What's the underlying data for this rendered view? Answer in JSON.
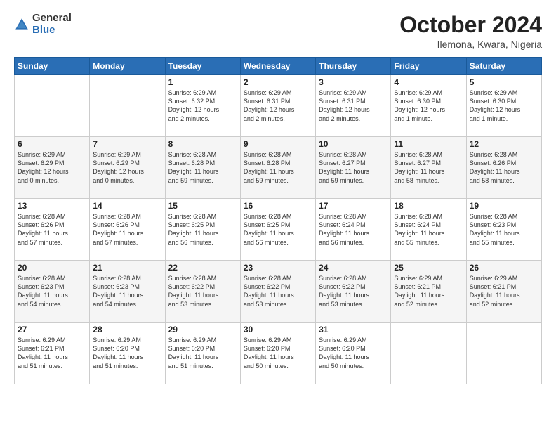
{
  "logo": {
    "general": "General",
    "blue": "Blue"
  },
  "title": {
    "month": "October 2024",
    "location": "Ilemona, Kwara, Nigeria"
  },
  "weekdays": [
    "Sunday",
    "Monday",
    "Tuesday",
    "Wednesday",
    "Thursday",
    "Friday",
    "Saturday"
  ],
  "weeks": [
    [
      {
        "day": "",
        "info": ""
      },
      {
        "day": "",
        "info": ""
      },
      {
        "day": "1",
        "info": "Sunrise: 6:29 AM\nSunset: 6:32 PM\nDaylight: 12 hours\nand 2 minutes."
      },
      {
        "day": "2",
        "info": "Sunrise: 6:29 AM\nSunset: 6:31 PM\nDaylight: 12 hours\nand 2 minutes."
      },
      {
        "day": "3",
        "info": "Sunrise: 6:29 AM\nSunset: 6:31 PM\nDaylight: 12 hours\nand 2 minutes."
      },
      {
        "day": "4",
        "info": "Sunrise: 6:29 AM\nSunset: 6:30 PM\nDaylight: 12 hours\nand 1 minute."
      },
      {
        "day": "5",
        "info": "Sunrise: 6:29 AM\nSunset: 6:30 PM\nDaylight: 12 hours\nand 1 minute."
      }
    ],
    [
      {
        "day": "6",
        "info": "Sunrise: 6:29 AM\nSunset: 6:29 PM\nDaylight: 12 hours\nand 0 minutes."
      },
      {
        "day": "7",
        "info": "Sunrise: 6:29 AM\nSunset: 6:29 PM\nDaylight: 12 hours\nand 0 minutes."
      },
      {
        "day": "8",
        "info": "Sunrise: 6:28 AM\nSunset: 6:28 PM\nDaylight: 11 hours\nand 59 minutes."
      },
      {
        "day": "9",
        "info": "Sunrise: 6:28 AM\nSunset: 6:28 PM\nDaylight: 11 hours\nand 59 minutes."
      },
      {
        "day": "10",
        "info": "Sunrise: 6:28 AM\nSunset: 6:27 PM\nDaylight: 11 hours\nand 59 minutes."
      },
      {
        "day": "11",
        "info": "Sunrise: 6:28 AM\nSunset: 6:27 PM\nDaylight: 11 hours\nand 58 minutes."
      },
      {
        "day": "12",
        "info": "Sunrise: 6:28 AM\nSunset: 6:26 PM\nDaylight: 11 hours\nand 58 minutes."
      }
    ],
    [
      {
        "day": "13",
        "info": "Sunrise: 6:28 AM\nSunset: 6:26 PM\nDaylight: 11 hours\nand 57 minutes."
      },
      {
        "day": "14",
        "info": "Sunrise: 6:28 AM\nSunset: 6:26 PM\nDaylight: 11 hours\nand 57 minutes."
      },
      {
        "day": "15",
        "info": "Sunrise: 6:28 AM\nSunset: 6:25 PM\nDaylight: 11 hours\nand 56 minutes."
      },
      {
        "day": "16",
        "info": "Sunrise: 6:28 AM\nSunset: 6:25 PM\nDaylight: 11 hours\nand 56 minutes."
      },
      {
        "day": "17",
        "info": "Sunrise: 6:28 AM\nSunset: 6:24 PM\nDaylight: 11 hours\nand 56 minutes."
      },
      {
        "day": "18",
        "info": "Sunrise: 6:28 AM\nSunset: 6:24 PM\nDaylight: 11 hours\nand 55 minutes."
      },
      {
        "day": "19",
        "info": "Sunrise: 6:28 AM\nSunset: 6:23 PM\nDaylight: 11 hours\nand 55 minutes."
      }
    ],
    [
      {
        "day": "20",
        "info": "Sunrise: 6:28 AM\nSunset: 6:23 PM\nDaylight: 11 hours\nand 54 minutes."
      },
      {
        "day": "21",
        "info": "Sunrise: 6:28 AM\nSunset: 6:23 PM\nDaylight: 11 hours\nand 54 minutes."
      },
      {
        "day": "22",
        "info": "Sunrise: 6:28 AM\nSunset: 6:22 PM\nDaylight: 11 hours\nand 53 minutes."
      },
      {
        "day": "23",
        "info": "Sunrise: 6:28 AM\nSunset: 6:22 PM\nDaylight: 11 hours\nand 53 minutes."
      },
      {
        "day": "24",
        "info": "Sunrise: 6:28 AM\nSunset: 6:22 PM\nDaylight: 11 hours\nand 53 minutes."
      },
      {
        "day": "25",
        "info": "Sunrise: 6:29 AM\nSunset: 6:21 PM\nDaylight: 11 hours\nand 52 minutes."
      },
      {
        "day": "26",
        "info": "Sunrise: 6:29 AM\nSunset: 6:21 PM\nDaylight: 11 hours\nand 52 minutes."
      }
    ],
    [
      {
        "day": "27",
        "info": "Sunrise: 6:29 AM\nSunset: 6:21 PM\nDaylight: 11 hours\nand 51 minutes."
      },
      {
        "day": "28",
        "info": "Sunrise: 6:29 AM\nSunset: 6:20 PM\nDaylight: 11 hours\nand 51 minutes."
      },
      {
        "day": "29",
        "info": "Sunrise: 6:29 AM\nSunset: 6:20 PM\nDaylight: 11 hours\nand 51 minutes."
      },
      {
        "day": "30",
        "info": "Sunrise: 6:29 AM\nSunset: 6:20 PM\nDaylight: 11 hours\nand 50 minutes."
      },
      {
        "day": "31",
        "info": "Sunrise: 6:29 AM\nSunset: 6:20 PM\nDaylight: 11 hours\nand 50 minutes."
      },
      {
        "day": "",
        "info": ""
      },
      {
        "day": "",
        "info": ""
      }
    ]
  ]
}
